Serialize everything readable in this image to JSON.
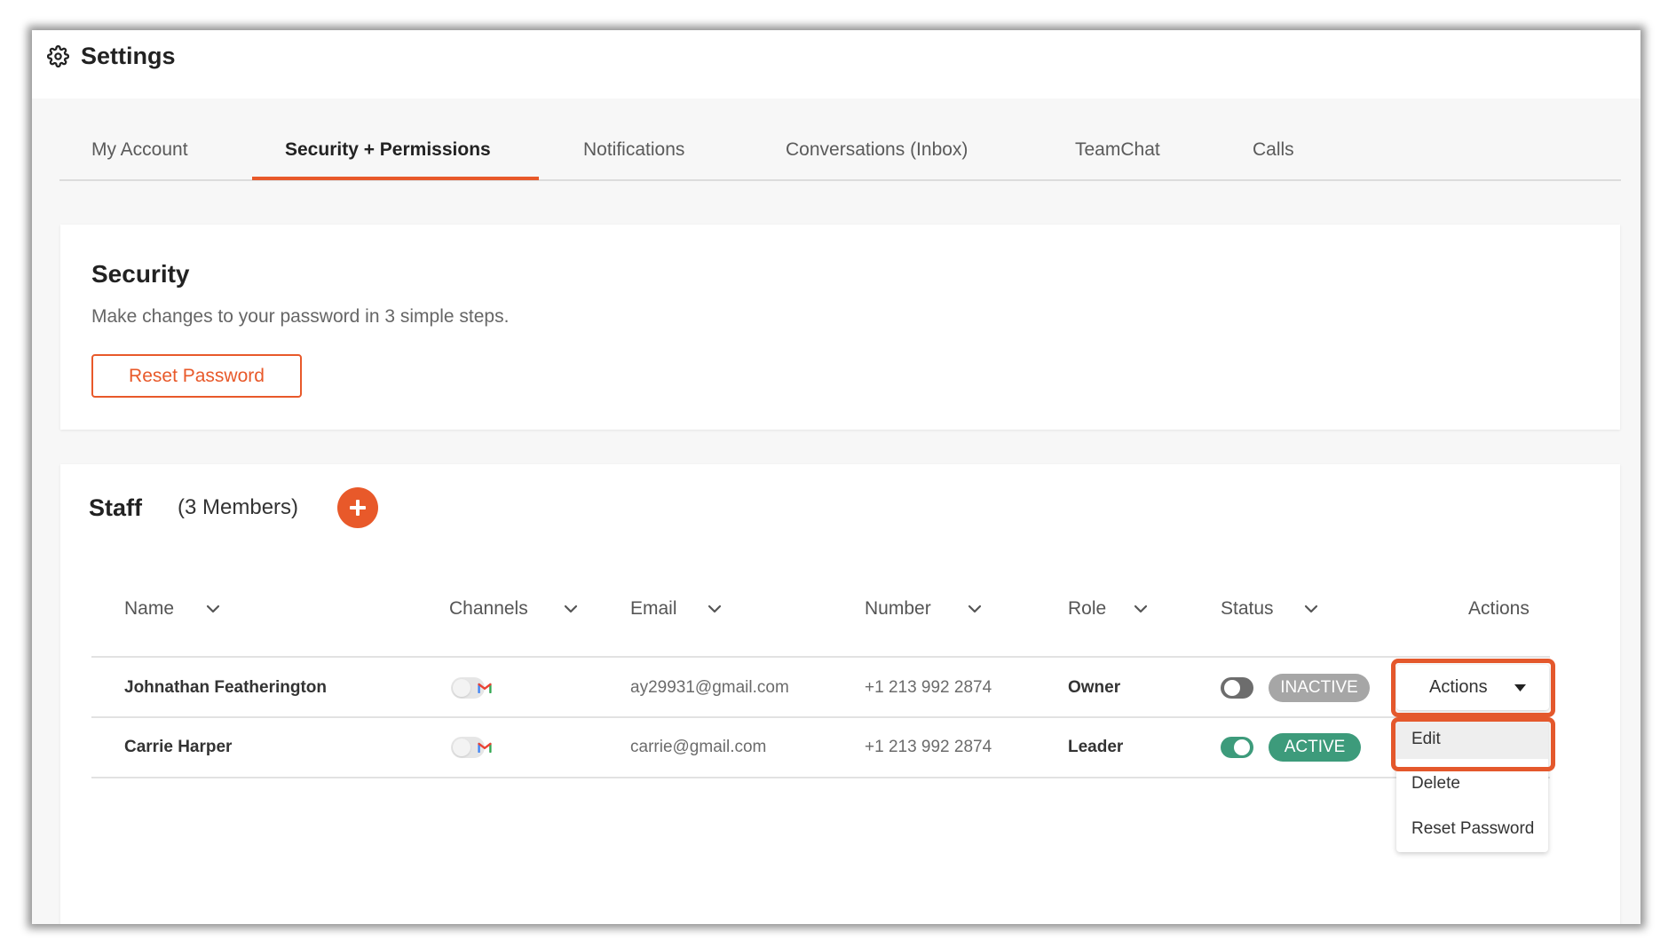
{
  "window": {
    "title": "Settings",
    "title_icon": "gear-icon"
  },
  "tabs": [
    {
      "label": "My Account",
      "active": false
    },
    {
      "label": "Security + Permissions",
      "active": true
    },
    {
      "label": "Notifications",
      "active": false
    },
    {
      "label": "Conversations (Inbox)",
      "active": false
    },
    {
      "label": "TeamChat",
      "active": false
    },
    {
      "label": "Calls",
      "active": false
    }
  ],
  "security": {
    "title": "Security",
    "description": "Make changes to your password in 3 simple steps.",
    "reset_button_label": "Reset Password"
  },
  "staff": {
    "title": "Staff",
    "member_count_label": "(3 Members)",
    "add_button_icon": "plus-icon",
    "columns": [
      {
        "label": "Name",
        "icon": "chevron-down-icon"
      },
      {
        "label": "Channels",
        "icon": "chevron-down-icon"
      },
      {
        "label": "Email",
        "icon": "chevron-down-icon"
      },
      {
        "label": "Number",
        "icon": "chevron-down-icon"
      },
      {
        "label": "Role",
        "icon": "chevron-down-icon"
      },
      {
        "label": "Status",
        "icon": "chevron-down-icon"
      },
      {
        "label": "Actions",
        "icon": null
      }
    ],
    "rows": [
      {
        "name": "Johnathan Featherington",
        "channel_icon": "gmail-icon",
        "email": "ay29931@gmail.com",
        "number": "+1 213 992 2874",
        "role": "Owner",
        "status_active": false,
        "status_label": "INACTIVE"
      },
      {
        "name": "Carrie Harper",
        "channel_icon": "gmail-icon",
        "email": "carrie@gmail.com",
        "number": "+1 213 992 2874",
        "role": "Leader",
        "status_active": true,
        "status_label": "ACTIVE"
      }
    ],
    "actions_button": {
      "label": "Actions",
      "icon": "caret-down-icon",
      "open": true
    },
    "actions_menu": [
      {
        "label": "Edit",
        "highlighted": true
      },
      {
        "label": "Delete",
        "highlighted": false
      },
      {
        "label": "Reset Password",
        "highlighted": false
      }
    ]
  },
  "colors": {
    "accent": "#e8592a",
    "active_green": "#3d9b7b",
    "inactive_gray": "#a6a6a6",
    "annotation_highlight": "#e4582c"
  }
}
